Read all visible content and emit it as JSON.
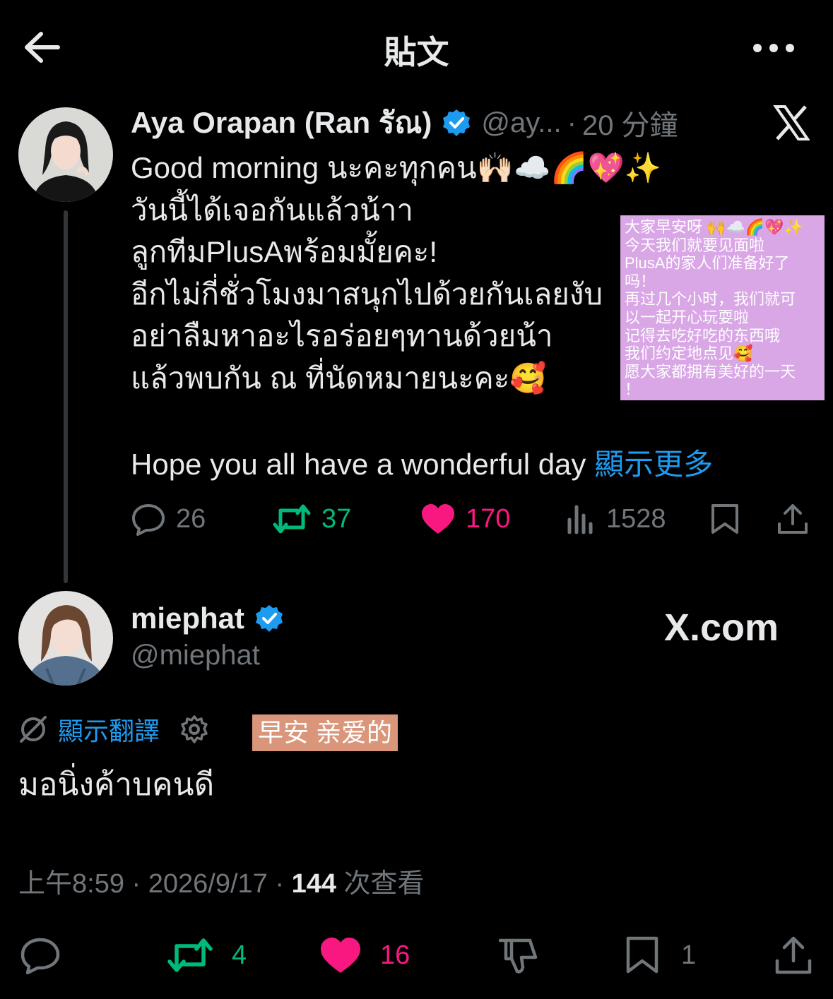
{
  "topbar": {
    "title": "貼文"
  },
  "parent": {
    "name": "Aya Orapan (Ran รัณ)",
    "handle": "@ay...",
    "sep": "·",
    "time": "20 分鐘",
    "lines": [
      "Good morning นะคะทุกคน🙌🏻☁️🌈💖✨",
      "วันนี้ได้เจอกันแล้วน้าา",
      "ลูกทีมPlusAพร้อมมั้ยคะ!",
      "อีกไม่กี่ชั่วโมงมาสนุกไปด้วยกันเลยงับ",
      "อย่าลืมหาอะไรอร่อยๆทานด้วยน้า",
      "แล้วพบกัน ณ ที่นัดหมายนะคะ🥰"
    ],
    "last_line": "Hope you all have a wonderful day",
    "show_more": "顯示更多",
    "replies": "26",
    "retweets": "37",
    "likes": "170",
    "views": "1528"
  },
  "annotation": {
    "lines": [
      "大家早安呀 🙌☁️🌈💖✨",
      "今天我们就要见面啦",
      "PlusA的家人们准备好了",
      "吗！",
      "再过几个小时，我们就可",
      "以一起开心玩耍啦",
      "记得去吃好吃的东西哦",
      "我们约定地点见🥰",
      "愿大家都拥有美好的一天",
      "！"
    ]
  },
  "reply": {
    "name": "miephat",
    "handle": "@miephat",
    "watermark": "X.com",
    "translate_label": "顯示翻譯",
    "badge": "早安 亲爱的",
    "text": "มอนิ่งค้าบคนดี",
    "time": "上午8:59",
    "dot": " · ",
    "date": "2026/9/17",
    "views_count": "144",
    "views_label": " 次查看",
    "retweets": "4",
    "likes": "16",
    "bookmarks": "1"
  },
  "colors": {
    "background": "#000000",
    "text": "#e7e9ea",
    "muted": "#71767b",
    "link": "#1d9bf0",
    "retweet": "#00ba7c",
    "like": "#f91880",
    "annotation_bg": "#d9a6e6",
    "badge_bg": "#d9967a"
  },
  "icons": [
    "back-arrow-icon",
    "more-icon",
    "verified-icon",
    "x-logo-icon",
    "reply-icon",
    "retweet-icon",
    "heart-icon",
    "views-icon",
    "bookmark-icon",
    "share-icon",
    "translate-icon",
    "gear-icon",
    "dislike-icon"
  ]
}
